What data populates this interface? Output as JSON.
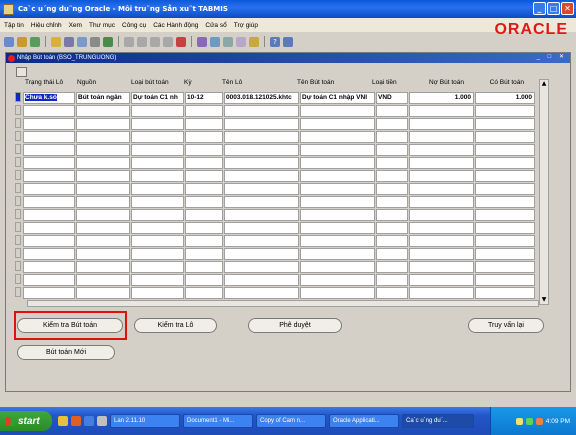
{
  "window": {
    "title": "Ca`c u´ng du¨ng Oracle - Môi tru¨ng Sån xu¨t TABMIS"
  },
  "menu": [
    "Tập tin",
    "Hiệu chỉnh",
    "Xem",
    "Thư mục",
    "Công cụ",
    "Các Hành động",
    "Cửa sổ",
    "Trợ giúp"
  ],
  "logo_text": "ORACLE",
  "form": {
    "title": "Nhập Bút toán (BSO_TRUNGUONG)",
    "columns": [
      "Trạng thái Lô",
      "Nguồn",
      "Loại bút toán",
      "Kỳ",
      "Tên Lô",
      "Tên Bút toán",
      "Loại tiền",
      "Nợ Bút toán",
      "Có Bút toán"
    ],
    "rows": [
      {
        "status": "Chưa k.sổ",
        "source": "Bút toán ngân",
        "category": "Dự toán C1 nh",
        "period": "10-12",
        "batch": "0003.018.121025.khtc",
        "journal": "Dự toán C1 nhập VNI",
        "currency": "VND",
        "debit": "1.000",
        "credit": "1.000"
      }
    ],
    "empty_rows": 15
  },
  "buttons": {
    "check_journal": "Kiểm tra Bút toán",
    "check_batch": "Kiểm tra Lô",
    "approve": "Phê duyệt",
    "query": "Truy vấn lại",
    "new_journal": "Bút toán Mới"
  },
  "taskbar": {
    "start": "start",
    "tasks": [
      "Lan 2.11.10",
      "Document1 - Mi...",
      "Copy of Cam n...",
      "Oracle Applicati...",
      "Ca`c u´ng du¨..."
    ],
    "clock": "4:09 PM"
  },
  "colors": {
    "titlebar": "#0a5ad8",
    "oracle_red": "#e01818",
    "selection_blue": "#1028c8",
    "highlight_red": "#e01010"
  }
}
